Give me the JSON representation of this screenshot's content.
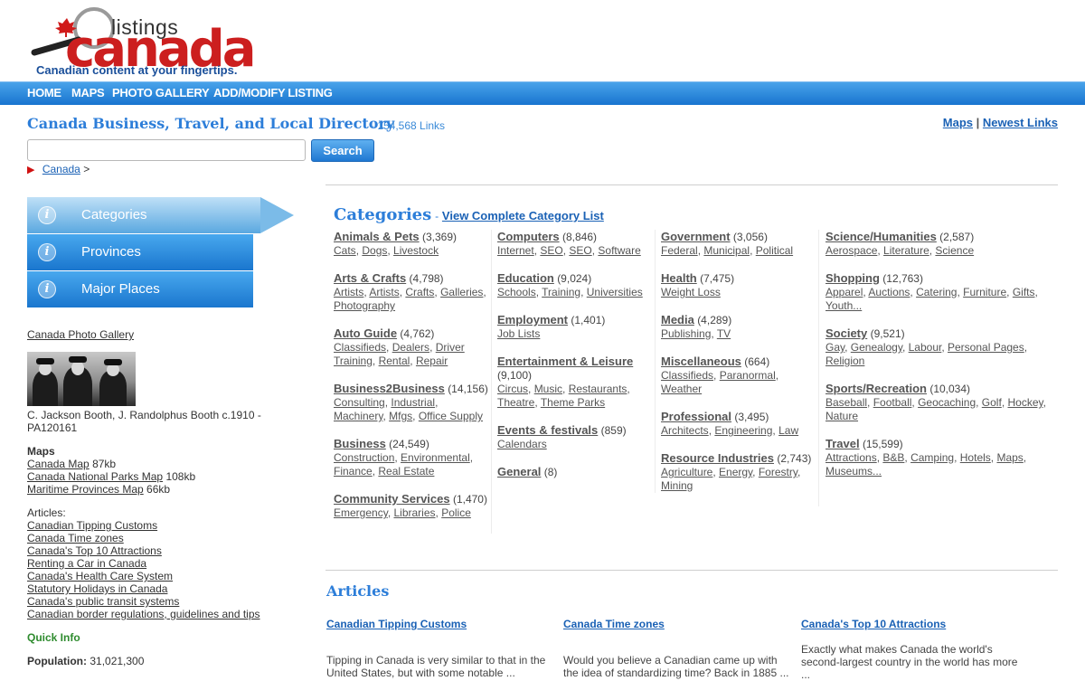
{
  "logo": {
    "word1": "listings",
    "word2": "canada",
    "tagline": "Canadian content at your fingertips."
  },
  "nav": [
    "HOME",
    "MAPS",
    "PHOTO GALLERY",
    "ADD/MODIFY LISTING"
  ],
  "header": {
    "title": "Canada Business, Travel, and Local Directory",
    "link_count": "- 154,568 Links",
    "maps_link": "Maps",
    "separator": "|",
    "newest_link": "Newest Links"
  },
  "search": {
    "placeholder": "",
    "button": "Search"
  },
  "breadcrumb": {
    "item": "Canada",
    "sep": ">"
  },
  "sidebar": {
    "tabs": [
      "Categories",
      "Provinces",
      "Major Places"
    ],
    "gallery_link": "Canada Photo Gallery",
    "photo_caption_line1": "C. Jackson Booth, J. Randolphus Booth c.1910 -",
    "photo_caption_line2": "PA120161",
    "maps_heading": "Maps",
    "maps": [
      {
        "label": "Canada Map",
        "size": "87kb"
      },
      {
        "label": "Canada National Parks Map",
        "size": "108kb"
      },
      {
        "label": "Maritime Provinces Map",
        "size": "66kb"
      }
    ],
    "articles_heading": "Articles:",
    "articles": [
      "Canadian Tipping Customs",
      "Canada Time zones",
      "Canada's Top 10 Attractions",
      "Renting a Car in Canada",
      "Canada's Health Care System",
      "Statutory Holidays in Canada",
      "Canada's public transit systems",
      "Canadian border regulations, guidelines and tips"
    ],
    "quick_info_heading": "Quick Info",
    "population_label": "Population:",
    "population_value": "31,021,300"
  },
  "categories": {
    "heading": "Categories",
    "dash": "-",
    "view_all": "View Complete Category List",
    "columns": [
      [
        {
          "name": "Animals & Pets",
          "count": "(3,369)",
          "subs": [
            "Cats",
            "Dogs",
            "Livestock"
          ]
        },
        {
          "name": "Arts & Crafts",
          "count": "(4,798)",
          "subs": [
            "Artists",
            "Artists",
            "Crafts",
            "Galleries",
            "Photography"
          ]
        },
        {
          "name": "Auto Guide",
          "count": "(4,762)",
          "subs": [
            "Classifieds",
            "Dealers",
            "Driver Training",
            "Rental",
            "Repair"
          ]
        },
        {
          "name": "Business2Business",
          "count": "(14,156)",
          "subs": [
            "Consulting",
            "Industrial",
            "Machinery",
            "Mfgs",
            "Office Supply"
          ]
        },
        {
          "name": "Business",
          "count": "(24,549)",
          "subs": [
            "Construction",
            "Environmental",
            "Finance",
            "Real Estate"
          ]
        },
        {
          "name": "Community Services",
          "count": "(1,470)",
          "subs": [
            "Emergency",
            "Libraries",
            "Police"
          ]
        }
      ],
      [
        {
          "name": "Computers",
          "count": "(8,846)",
          "subs": [
            "Internet",
            "SEO",
            "SEO",
            "Software"
          ]
        },
        {
          "name": "Education",
          "count": "(9,024)",
          "subs": [
            "Schools",
            "Training",
            "Universities"
          ]
        },
        {
          "name": "Employment",
          "count": "(1,401)",
          "subs": [
            "Job Lists"
          ]
        },
        {
          "name": "Entertainment & Leisure",
          "count": "(9,100)",
          "subs": [
            "Circus",
            "Music",
            "Restaurants",
            "Theatre",
            "Theme Parks"
          ]
        },
        {
          "name": "Events & festivals",
          "count": "(859)",
          "subs": [
            "Calendars"
          ]
        },
        {
          "name": "General",
          "count": "(8)",
          "subs": []
        }
      ],
      [
        {
          "name": "Government",
          "count": "(3,056)",
          "subs": [
            "Federal",
            "Municipal",
            "Political"
          ]
        },
        {
          "name": "Health",
          "count": "(7,475)",
          "subs": [
            "Weight Loss"
          ]
        },
        {
          "name": "Media",
          "count": "(4,289)",
          "subs": [
            "Publishing",
            "TV"
          ]
        },
        {
          "name": "Miscellaneous",
          "count": "(664)",
          "subs": [
            "Classifieds",
            "Paranormal",
            "Weather"
          ]
        },
        {
          "name": "Professional",
          "count": "(3,495)",
          "subs": [
            "Architects",
            "Engineering",
            "Law"
          ]
        },
        {
          "name": "Resource Industries",
          "count": "(2,743)",
          "subs": [
            "Agriculture",
            "Energy",
            "Forestry",
            "Mining"
          ]
        }
      ],
      [
        {
          "name": "Science/Humanities",
          "count": "(2,587)",
          "subs": [
            "Aerospace",
            "Literature",
            "Science"
          ]
        },
        {
          "name": "Shopping",
          "count": "(12,763)",
          "subs": [
            "Apparel",
            "Auctions",
            "Catering",
            "Furniture",
            "Gifts",
            "Youth..."
          ]
        },
        {
          "name": "Society",
          "count": "(9,521)",
          "subs": [
            "Gay",
            "Genealogy",
            "Labour",
            "Personal Pages",
            "Religion"
          ]
        },
        {
          "name": "Sports/Recreation",
          "count": "(10,034)",
          "subs": [
            "Baseball",
            "Football",
            "Geocaching",
            "Golf",
            "Hockey",
            "Nature"
          ]
        },
        {
          "name": "Travel",
          "count": "(15,599)",
          "subs": [
            "Attractions",
            "B&B",
            "Camping",
            "Hotels",
            "Maps",
            "Museums..."
          ]
        }
      ]
    ]
  },
  "articles_section": {
    "heading": "Articles",
    "items": [
      {
        "title": "Canadian Tipping Customs",
        "text": "Tipping in Canada is very similar to that in the United States, but with some notable ..."
      },
      {
        "title": "Canada Time zones",
        "text": "Would you believe a Canadian came up with the idea of standardizing time? Back in 1885 ..."
      },
      {
        "title": "Canada's Top 10 Attractions",
        "text": "Exactly what makes Canada the world's second-largest country in the world has more ..."
      }
    ]
  },
  "colors": {
    "accent": "#2d7ed9",
    "nav": "#1874cf",
    "brand_red": "#cc1f1f"
  }
}
